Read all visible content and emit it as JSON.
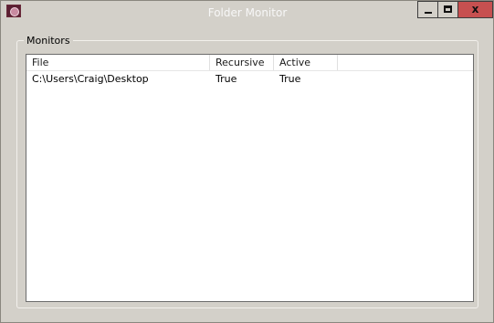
{
  "window": {
    "title": "Folder Monitor",
    "close_glyph": "x"
  },
  "icons": {
    "app": "folder-monitor-app-icon",
    "minimize": "minimize-icon",
    "maximize": "maximize-icon",
    "close": "close-icon"
  },
  "colors": {
    "window_bg": "#d3d0c9",
    "close_button": "#c75050",
    "list_bg": "#ffffff"
  },
  "group": {
    "label": "Monitors"
  },
  "table": {
    "columns": [
      "File",
      "Recursive",
      "Active"
    ],
    "rows": [
      [
        "C:\\Users\\Craig\\Desktop",
        "True",
        "True"
      ]
    ]
  }
}
